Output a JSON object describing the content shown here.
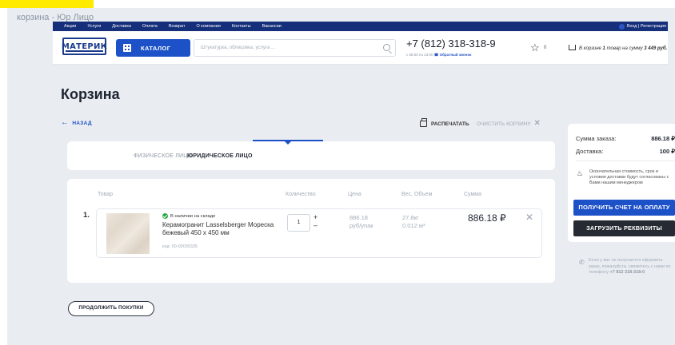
{
  "window": {
    "caption": "корзина - Юр Лицо"
  },
  "topbar": {
    "nav": [
      "Акции",
      "Услуги",
      "Доставка",
      "Оплата",
      "Возврат",
      "О компании",
      "Контакты",
      "Вакансии"
    ],
    "login_label": "Вход | Регистрация"
  },
  "header": {
    "logo_text": "МАТЕРИК",
    "catalog_label": "КАТАЛОГ",
    "search_placeholder": "Штукатурка, облицовка, услуга ...",
    "phone": "+7 (812) 318-318-9",
    "phone_hours": "с 08:00 по 23:00",
    "callback_label": "Обратный звонок",
    "favorites_count": "0",
    "cart_text_prefix": "В корзине",
    "cart_items": "1",
    "cart_text_mid": "товар на сумму",
    "cart_sum": "3 449 руб."
  },
  "page": {
    "title": "Корзина",
    "back_label": "НАЗАД",
    "print_label": "РАСПЕЧАТАТЬ",
    "clear_label": "ОЧИСТИТЬ КОРЗИНУ",
    "tabs": [
      {
        "label": "ФИЗИЧЕСКОЕ ЛИЦО",
        "active": false
      },
      {
        "label": "ЮРИДИЧЕСКОЕ ЛИЦО",
        "active": true
      }
    ],
    "continue_label": "ПРОДОЛЖИТЬ ПОКУПКИ"
  },
  "table": {
    "headers": [
      "Товар",
      "Количество",
      "Цена",
      "Вес, Объем",
      "Сумма"
    ],
    "rows": [
      {
        "num": "1.",
        "stock": "В наличии на складе",
        "name": "Керамогранит Lasselsberger Мореска бежевый 450 х 450 мм",
        "code": "код: 00-00035335",
        "qty": "1",
        "price": "886.18",
        "price_unit": "руб/упак",
        "weight": "27.8кг",
        "volume": "0.012 м³",
        "sum": "886.18 ₽"
      }
    ]
  },
  "summary": {
    "order_label": "Сумма заказа:",
    "order_value": "886.18 ₽",
    "delivery_label": "Доставка:",
    "delivery_value": "100 ₽",
    "note": "Окончательная стоимость, срок и условия доставки будут согласованы с Вами нашим менеджером",
    "invoice_button": "ПОЛУЧИТЬ СЧЕТ НА ОПЛАТУ",
    "details_button": "ЗАГРУЗИТЬ РЕКВИЗИТЫ",
    "help_text": "Если у вас не получается оформить заказ, пожалуйста, свяжитесь с нами по телефону",
    "help_phone": "+7 812 318-318-0"
  },
  "colors": {
    "brand_blue": "#1d51c7",
    "topbar": "#152f7a",
    "dark_button": "#252a33",
    "background": "#e9edf2",
    "highlight": "#ffeb00"
  }
}
